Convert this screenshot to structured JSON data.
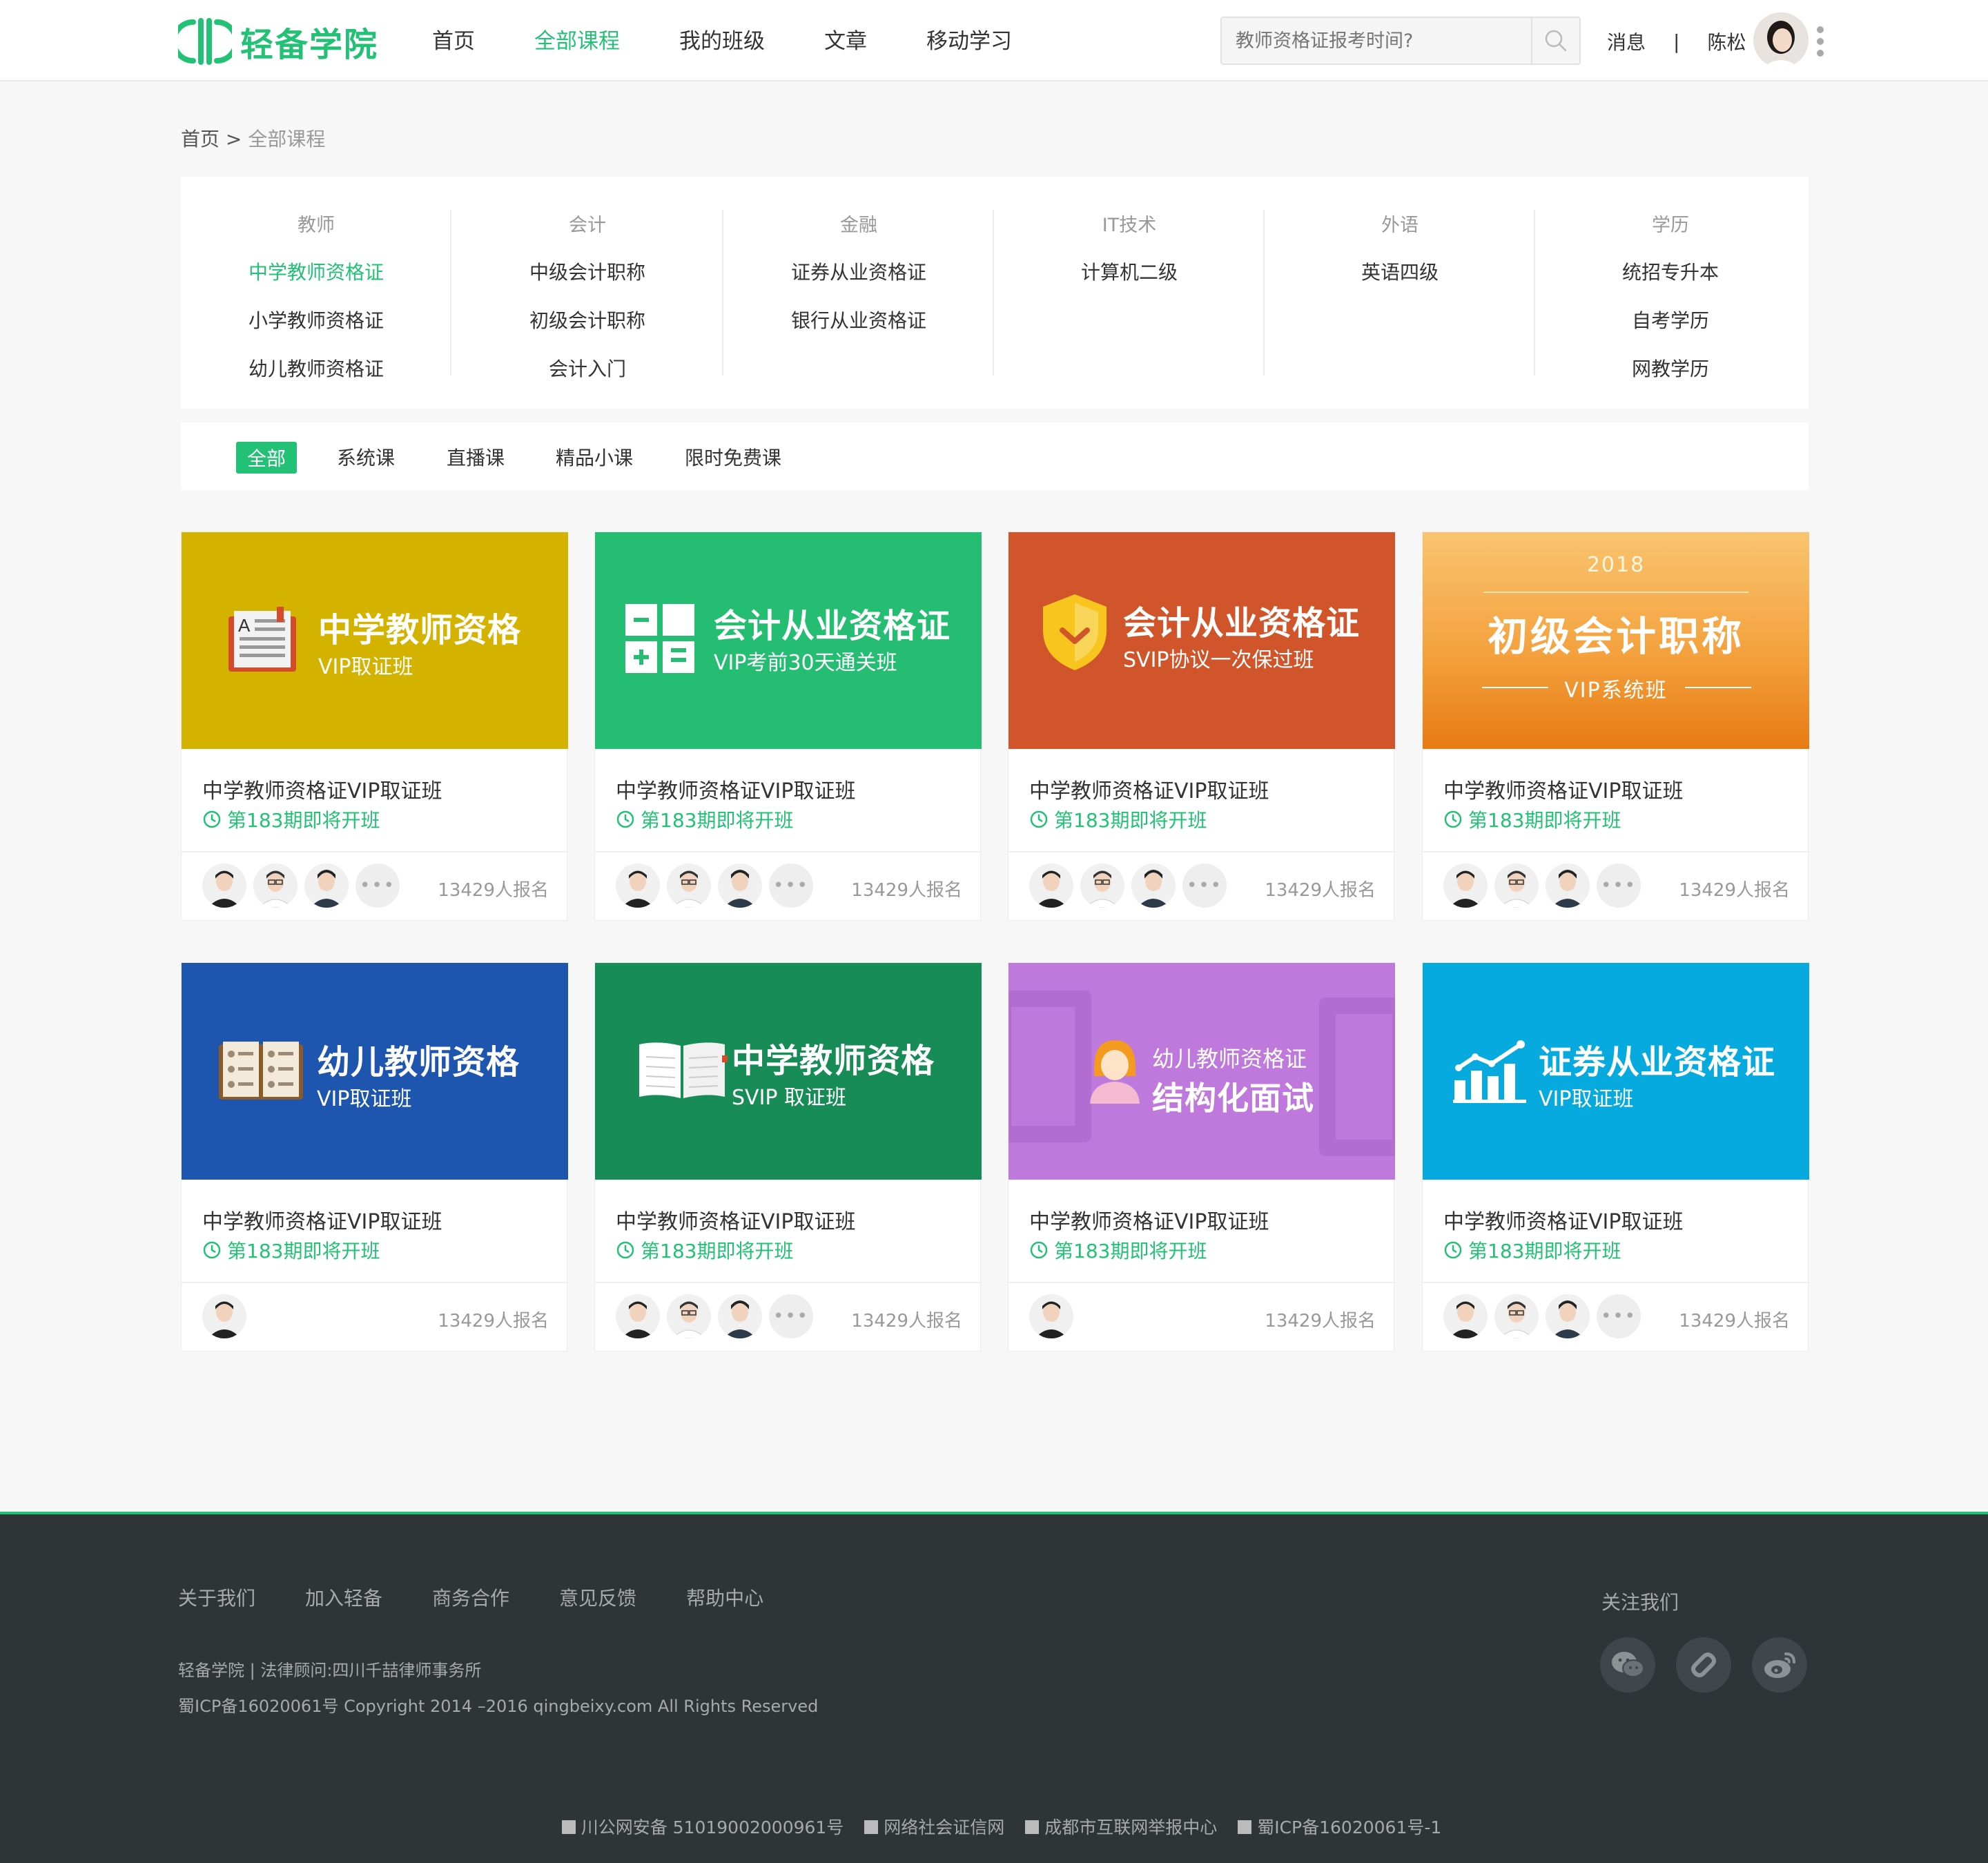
{
  "header": {
    "logo_text": "轻备学院",
    "nav": [
      "首页",
      "全部课程",
      "我的班级",
      "文章",
      "移动学习"
    ],
    "nav_active_index": 1,
    "search_placeholder": "教师资格证报考时间?",
    "messages": "消息",
    "separator": "|",
    "username": "陈松"
  },
  "breadcrumb": {
    "home": "首页",
    "sep": ">",
    "current": "全部课程"
  },
  "categories": [
    {
      "head": "教师",
      "items": [
        "中学教师资格证",
        "小学教师资格证",
        "幼儿教师资格证"
      ]
    },
    {
      "head": "会计",
      "items": [
        "中级会计职称",
        "初级会计职称",
        "会计入门"
      ]
    },
    {
      "head": "金融",
      "items": [
        "证券从业资格证",
        "银行从业资格证"
      ]
    },
    {
      "head": "IT技术",
      "items": [
        "计算机二级"
      ]
    },
    {
      "head": "外语",
      "items": [
        "英语四级"
      ]
    },
    {
      "head": "学历",
      "items": [
        "统招专升本",
        "自考学历",
        "网教学历"
      ]
    }
  ],
  "filters": [
    "全部",
    "系统课",
    "直播课",
    "精品小课",
    "限时免费课"
  ],
  "cards": [
    {
      "banner_title": "中学教师资格",
      "banner_sub": "VIP取证班",
      "banner_year": "",
      "title": "中学教师资格证VIP取证班",
      "status": "第183期即将开班",
      "count": "13429人报名",
      "more": "•••"
    },
    {
      "banner_title": "会计从业资格证",
      "banner_sub": "VIP考前30天通关班",
      "banner_year": "",
      "title": "中学教师资格证VIP取证班",
      "status": "第183期即将开班",
      "count": "13429人报名",
      "more": "•••"
    },
    {
      "banner_title": "会计从业资格证",
      "banner_sub": "SVIP协议一次保过班",
      "banner_year": "",
      "title": "中学教师资格证VIP取证班",
      "status": "第183期即将开班",
      "count": "13429人报名",
      "more": "•••"
    },
    {
      "banner_title": "初级会计职称",
      "banner_sub": "VIP系统班",
      "banner_year": "2018",
      "title": "中学教师资格证VIP取证班",
      "status": "第183期即将开班",
      "count": "13429人报名",
      "more": "•••"
    },
    {
      "banner_title": "幼儿教师资格",
      "banner_sub": "VIP取证班",
      "banner_year": "",
      "title": "中学教师资格证VIP取证班",
      "status": "第183期即将开班",
      "count": "13429人报名",
      "more": ""
    },
    {
      "banner_title": "中学教师资格",
      "banner_sub": "SVIP 取证班",
      "banner_year": "",
      "title": "中学教师资格证VIP取证班",
      "status": "第183期即将开班",
      "count": "13429人报名",
      "more": "•••"
    },
    {
      "banner_title": "结构化面试",
      "banner_sub": "幼儿教师资格证",
      "banner_year": "",
      "title": "中学教师资格证VIP取证班",
      "status": "第183期即将开班",
      "count": "13429人报名",
      "more": ""
    },
    {
      "banner_title": "证券从业资格证",
      "banner_sub": "VIP取证班",
      "banner_year": "",
      "title": "中学教师资格证VIP取证班",
      "status": "第183期即将开班",
      "count": "13429人报名",
      "more": "•••"
    }
  ],
  "footer": {
    "links": [
      "关于我们",
      "加入轻备",
      "商务合作",
      "意见反馈",
      "帮助中心"
    ],
    "info_line1": "轻备学院 | 法律顾问:四川千喆律师事务所",
    "info_line2": "蜀ICP备16020061号 Copyright 2014 –2016 qingbeixy.com All Rights Reserved",
    "follow": "关注我们",
    "bottom": [
      "川公网安备 51019002000961号",
      "网络社会证信网",
      "成都市互联网举报中心",
      "蜀ICP备16020061号-1"
    ]
  },
  "colors": {
    "accent": "#23c175",
    "footer_bg": "#2f3437"
  }
}
